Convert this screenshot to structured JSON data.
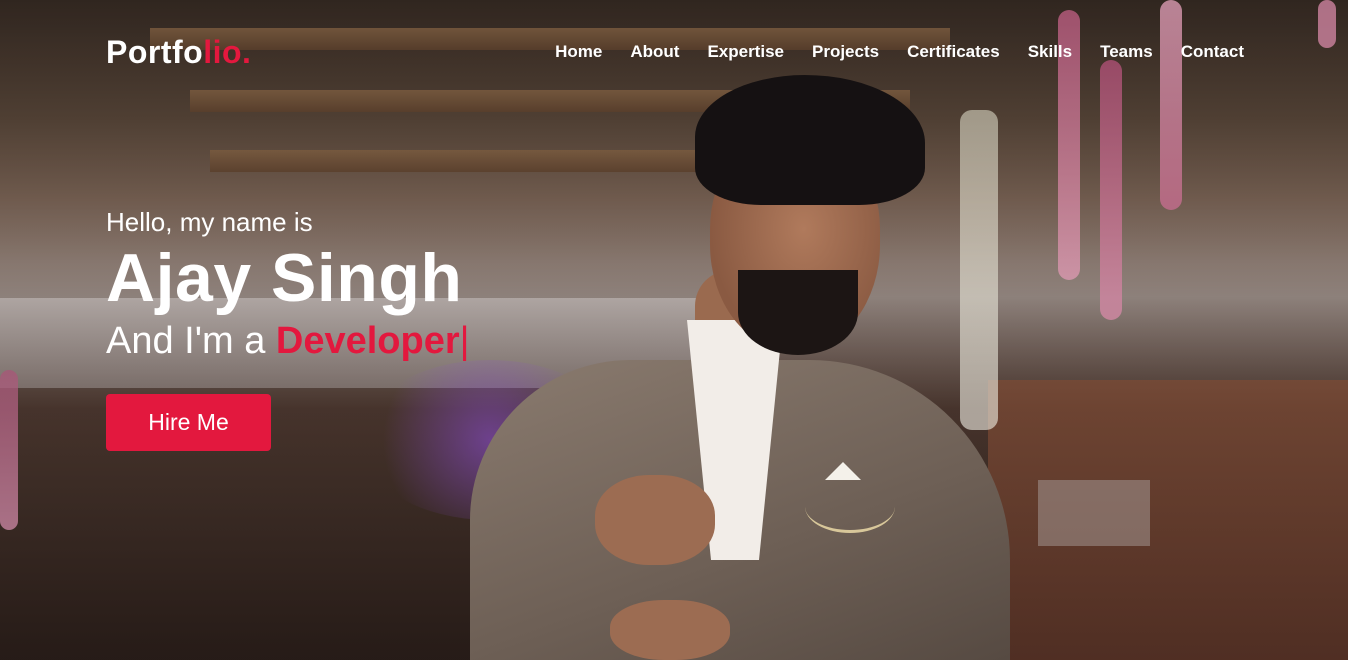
{
  "brand": {
    "logo_main": "Portfo",
    "logo_accent": "lio.",
    "accent_color": "#e3183e"
  },
  "nav": {
    "items": [
      {
        "label": "Home"
      },
      {
        "label": "About"
      },
      {
        "label": "Expertise"
      },
      {
        "label": "Projects"
      },
      {
        "label": "Certificates"
      },
      {
        "label": "Skills"
      },
      {
        "label": "Teams"
      },
      {
        "label": "Contact"
      }
    ]
  },
  "hero": {
    "greeting": "Hello, my name is",
    "name": "Ajay Singh",
    "role_prefix": "And I'm a",
    "role": "Developer",
    "cursor": "|",
    "cta_label": "Hire Me"
  }
}
